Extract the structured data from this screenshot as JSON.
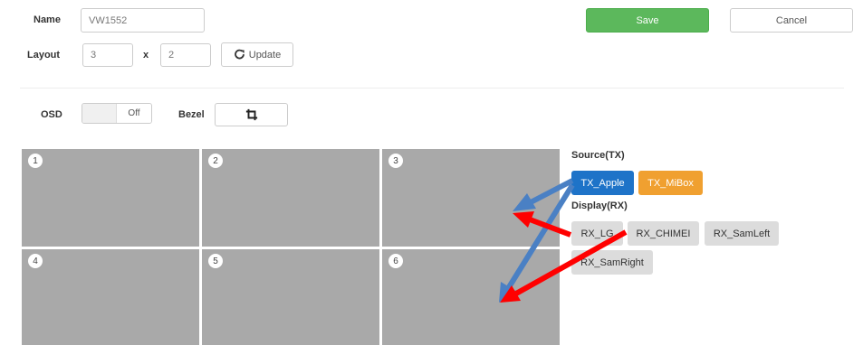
{
  "form": {
    "name_label": "Name",
    "name_value": "VW1552",
    "layout_label": "Layout",
    "layout_cols": "3",
    "layout_x": "x",
    "layout_rows": "2",
    "update_label": "Update",
    "save_label": "Save",
    "cancel_label": "Cancel",
    "osd_label": "OSD",
    "osd_state": "Off",
    "bezel_label": "Bezel"
  },
  "wall": {
    "cells": [
      "1",
      "2",
      "3",
      "4",
      "5",
      "6"
    ],
    "cell_color": "#a9a9a9"
  },
  "source": {
    "title": "Source(TX)",
    "items": [
      "TX_Apple",
      "TX_MiBox"
    ]
  },
  "display": {
    "title": "Display(RX)",
    "items": [
      "RX_LG",
      "RX_CHIMEI",
      "RX_SamLeft",
      "RX_SamRight"
    ]
  },
  "colors": {
    "save": "#5cb85c",
    "tx_apple": "#1e73c8",
    "tx_mibox": "#f0a030",
    "arrow_blue": "#4a80c4",
    "arrow_red": "#ff0000"
  },
  "icons": {
    "update": "refresh-icon",
    "bezel": "crop-icon"
  }
}
